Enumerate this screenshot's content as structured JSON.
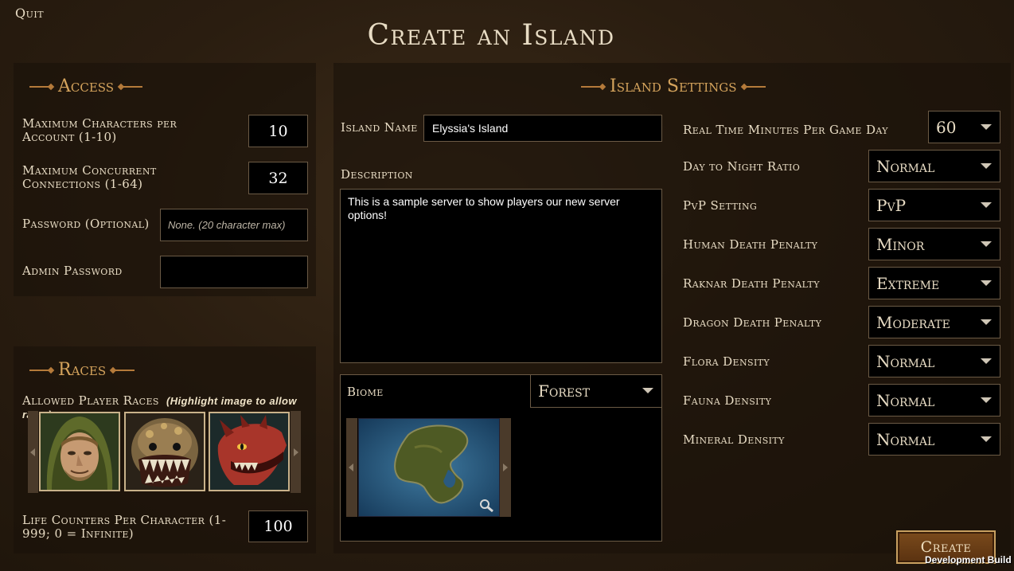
{
  "quit_label": "Quit",
  "title": "Create an Island",
  "access": {
    "heading": "Access",
    "max_chars_label": "Maximum Characters per Account (1-10)",
    "max_chars_value": "10",
    "max_conn_label": "Maximum Concurrent Connections (1-64)",
    "max_conn_value": "32",
    "password_label": "Password (Optional)",
    "password_placeholder": "None. (20 character max)",
    "admin_password_label": "Admin Password",
    "admin_password_value": ""
  },
  "races": {
    "heading": "Races",
    "allowed_label": "Allowed Player Races",
    "allowed_hint": "(Highlight image to allow race.)",
    "portraits": [
      "human",
      "raknar",
      "dragon"
    ],
    "life_counters_label": "Life Counters Per Character (1-999; 0 = Infinite)",
    "life_counters_value": "100"
  },
  "island_settings": {
    "heading": "Island Settings",
    "island_name_label": "Island Name",
    "island_name_value": "Elyssia's Island",
    "description_label": "Description",
    "description_value": "This is a sample server to show players our new server options!",
    "biome_label": "Biome",
    "biome_value": "Forest",
    "settings": [
      {
        "label": "Real Time Minutes Per Game Day",
        "value": "60"
      },
      {
        "label": "Day to Night Ratio",
        "value": "Normal"
      },
      {
        "label": "PvP Setting",
        "value": "PvP"
      },
      {
        "label": "Human Death Penalty",
        "value": "Minor"
      },
      {
        "label": "Raknar Death Penalty",
        "value": "Extreme"
      },
      {
        "label": "Dragon Death Penalty",
        "value": "Moderate"
      },
      {
        "label": "Flora Density",
        "value": "Normal"
      },
      {
        "label": "Fauna Density",
        "value": "Normal"
      },
      {
        "label": "Mineral Density",
        "value": "Normal"
      }
    ]
  },
  "create_label": "Create",
  "build_label": "Development Build",
  "colors": {
    "accent": "#d4a35c",
    "text": "#e8dcc4",
    "field_bg": "#000000",
    "border": "#6b5a45"
  }
}
